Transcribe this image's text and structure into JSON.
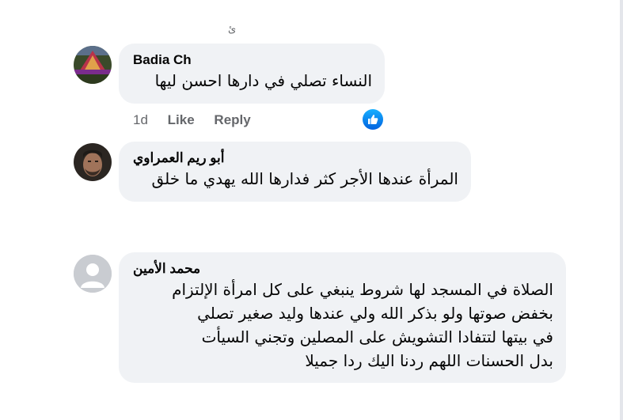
{
  "header": {
    "fragment": "ئ"
  },
  "colors": {
    "bubble": "#f0f2f5",
    "secondary_text": "#65676b",
    "like_blue": "#1877f2"
  },
  "comments": [
    {
      "author": "Badia Ch",
      "lines": [
        "النساء تصلي في دارها احسن ليها"
      ],
      "actions": {
        "time": "1d",
        "like": "Like",
        "reply": "Reply"
      },
      "reaction": "like-icon"
    },
    {
      "author": "أبو ريم العمراوي",
      "lines": [
        "المرأة عندها الأجر كثر فدارها الله يهدي ما خلق"
      ]
    },
    {
      "author": "محمد الأمين",
      "lines": [
        "الصلاة في المسجد لها شروط ينبغي على كل امرأة الإلتزام",
        "بخفض صوتها ولو بذكر الله ولي عندها وليد صغير تصلي",
        "في بيتها لتتفادا التشويش على المصلين وتجني السيأت",
        "بدل الحسنات اللهم ردنا اليك ردا جميلا"
      ]
    }
  ]
}
